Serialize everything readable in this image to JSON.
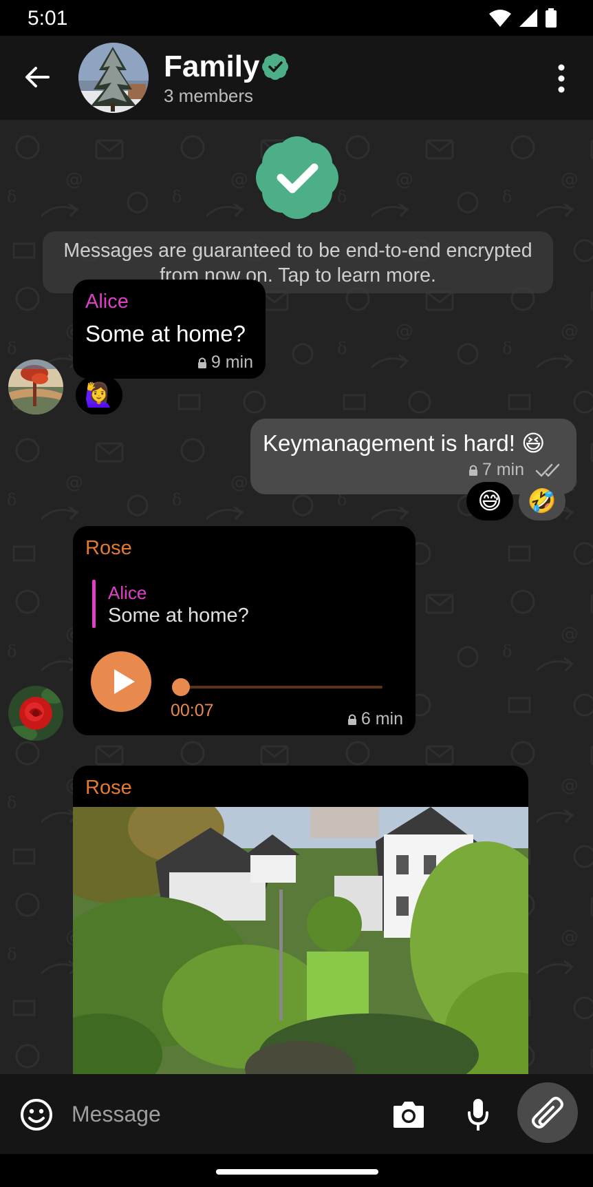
{
  "status_bar": {
    "time": "5:01"
  },
  "header": {
    "title": "Family",
    "subtitle": "3 members",
    "verified_color": "#4caf87"
  },
  "system_message": "Messages are guaranteed to be end-to-end encrypted from now on. Tap to learn more.",
  "messages": [
    {
      "sender": "Alice",
      "text": "Some at home?",
      "time": "9 min",
      "reactions": [
        "🙋‍♀️"
      ]
    },
    {
      "outgoing": true,
      "text": "Keymanagement is hard! 😆",
      "time": "7 min",
      "delivery": "read",
      "reactions": [
        "😅",
        "🤣"
      ]
    },
    {
      "sender": "Rose",
      "quote": {
        "sender": "Alice",
        "text": "Some at home?"
      },
      "voice": {
        "duration": "00:07",
        "progress": 0
      },
      "time": "6 min"
    },
    {
      "sender": "Rose",
      "type": "image",
      "description": "garden-houses-photo"
    }
  ],
  "composer": {
    "placeholder": "Message"
  },
  "colors": {
    "alice": "#e040c8",
    "rose": "#e67a2e",
    "accent_orange": "#e8894e",
    "verified_green": "#4caf87",
    "background": "#232323"
  },
  "icons": [
    "back-arrow-icon",
    "verified-icon",
    "more-vert-icon",
    "lock-icon",
    "double-check-icon",
    "play-icon",
    "emoji-icon",
    "camera-icon",
    "mic-icon",
    "paperclip-icon"
  ]
}
